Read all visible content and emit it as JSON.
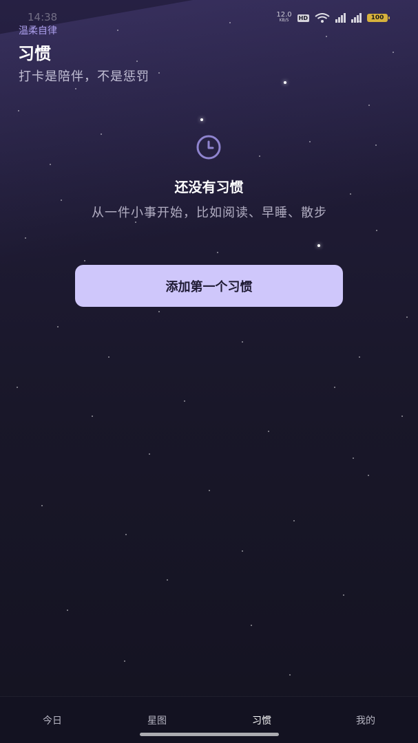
{
  "status_bar": {
    "time": "14:38",
    "net_speed_value": "12.0",
    "net_speed_unit": "KB/S",
    "hd_label": "HD",
    "sim1_label": "5G",
    "sim2_label": "5G",
    "battery": "100",
    "battery_color": "#d6b13c"
  },
  "header": {
    "app_name": "温柔自律",
    "title": "习惯",
    "subtitle": "打卡是陪伴，不是惩罚"
  },
  "empty_state": {
    "icon": "clock-icon",
    "title": "还没有习惯",
    "description": "从一件小事开始，比如阅读、早睡、散步",
    "button_label": "添加第一个习惯"
  },
  "bottom_nav": {
    "items": [
      {
        "label": "今日",
        "active": false
      },
      {
        "label": "星图",
        "active": false
      },
      {
        "label": "习惯",
        "active": true
      },
      {
        "label": "我的",
        "active": false
      }
    ]
  },
  "colors": {
    "accent": "#a99ce8",
    "button_bg": "#cfc7fb",
    "background": "#1f1b35"
  }
}
